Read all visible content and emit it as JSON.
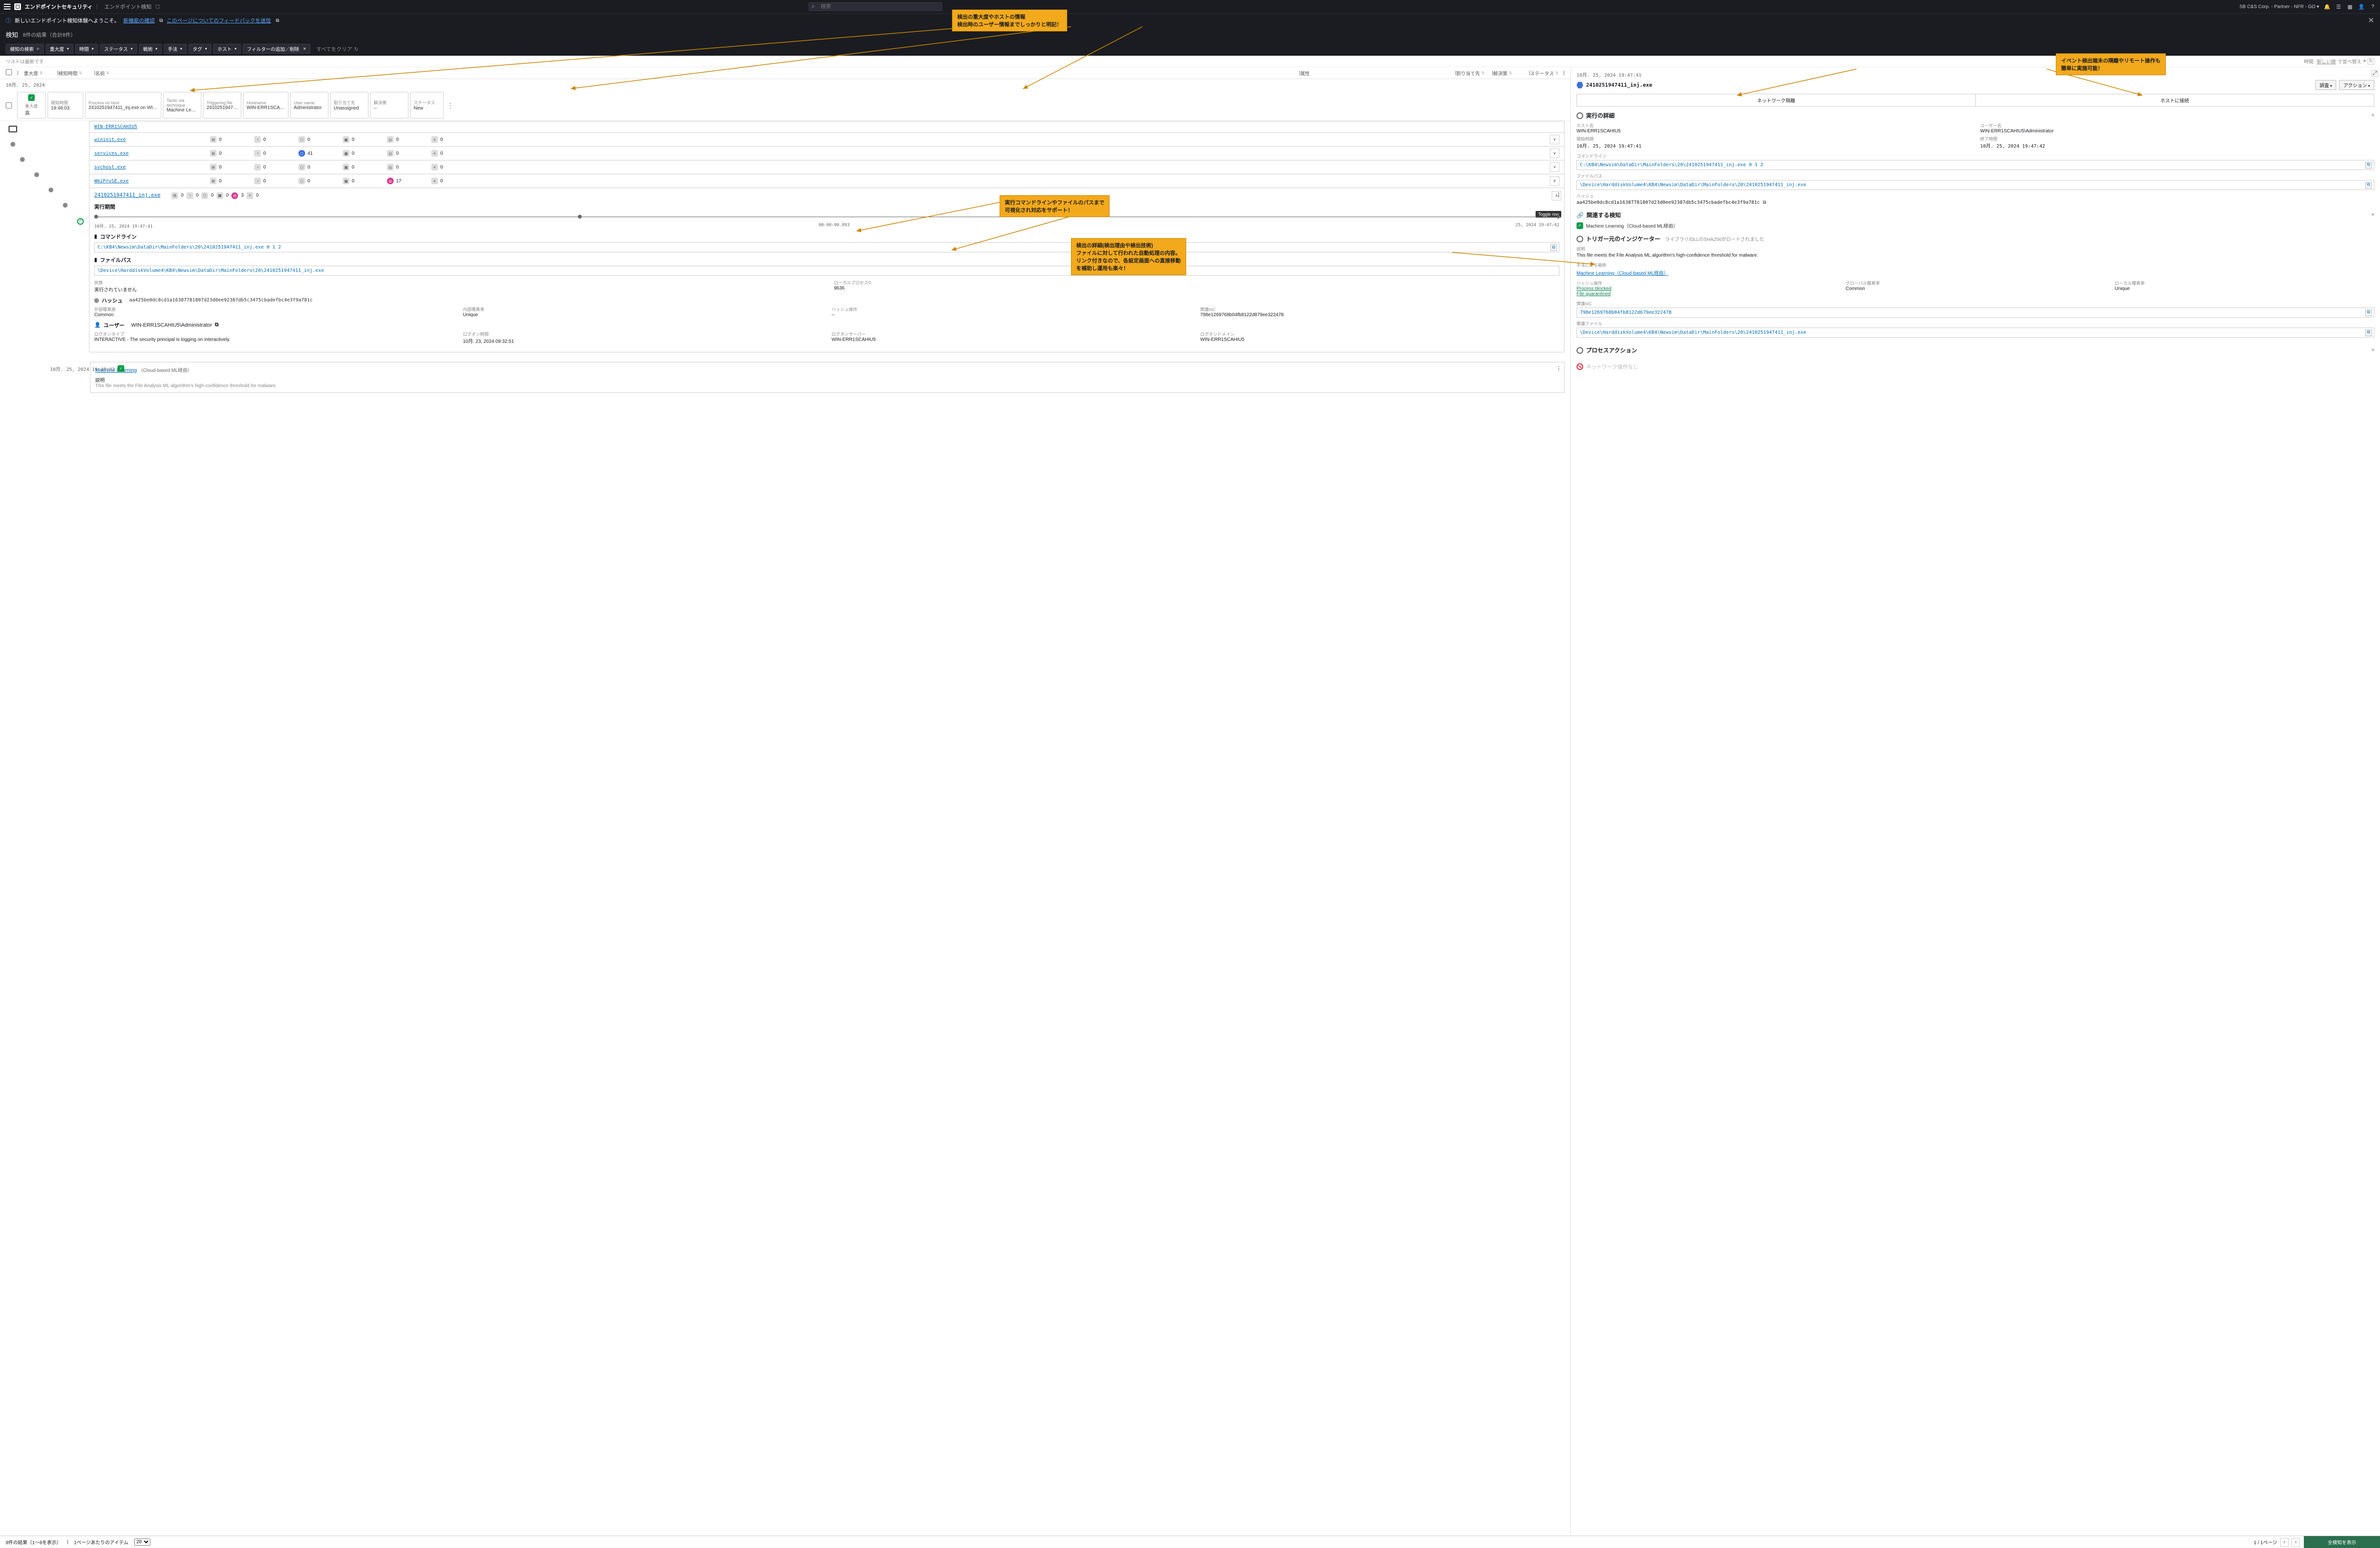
{
  "topbar": {
    "app_title": "エンドポイントセキュリティ",
    "subtitle": "エンドポイント検知",
    "bookmark_icon": "bookmark-icon",
    "search_placeholder": "検索",
    "tenant": "SB C&S Corp. - Partner - NFR - GO ▾"
  },
  "banner": {
    "text": "新しいエンドポイント検知体験へようこそ。",
    "link1": "新機能の確認",
    "link2": "このページについてのフィードバックを送信"
  },
  "result_header": {
    "title": "検知",
    "count_text": "8件の結果（合計8件）"
  },
  "filters": [
    {
      "label": "検知の検索",
      "cls": "search"
    },
    {
      "label": "重大度",
      "cls": "dd"
    },
    {
      "label": "時間",
      "cls": "dd"
    },
    {
      "label": "ステータス",
      "cls": "dd"
    },
    {
      "label": "戦術",
      "cls": "dd"
    },
    {
      "label": "手法",
      "cls": "dd"
    },
    {
      "label": "タグ",
      "cls": "dd"
    },
    {
      "label": "ホスト",
      "cls": "dd"
    },
    {
      "label": "フィルターの追加／削除",
      "cls": "close"
    }
  ],
  "filter_clear": "すべてをクリア",
  "statusbar": {
    "left": "リストは最新です",
    "sort_label": "時間:",
    "sort_value": "新しい順",
    "sort_suffix": "で並べ替え"
  },
  "columns": {
    "severity": "重大度",
    "time": "検知時間",
    "name": "名前",
    "attributes": "属性",
    "assigned": "割り当て先",
    "resolution": "解決策",
    "status": "ステータス"
  },
  "date_group": "10月. 25, 2024",
  "detection_row": {
    "severity_label": "重大度",
    "severity": "高",
    "time_label": "検知時間",
    "time": "19:48:03",
    "process_label": "Process on host",
    "process": "2410251947411_inj.exe on WIN-ERR1SCAHI...",
    "tactic_label": "Tactic via technique",
    "tactic": "Machine Learning...",
    "trigger_label": "Triggering file",
    "trigger": "2410251947411_inj...",
    "host_label": "Hostname",
    "host": "WIN-ERR1SCAHIU5",
    "user_label": "User name",
    "user": "Administrator",
    "assigned_label": "割り当て先",
    "assigned": "Unassigned",
    "resolution_label": "解決策",
    "resolution": "--",
    "status_label": "ステータス",
    "status": "New"
  },
  "process_tree": {
    "host": "WIN-ERR1SCAHIU5",
    "processes": [
      {
        "name": "wininit.exe",
        "s1": 0,
        "s2": 0,
        "s3": 0,
        "s4": 0,
        "s5": 0,
        "s6": 0,
        "highlight": null
      },
      {
        "name": "services.exe",
        "s1": 0,
        "s2": 0,
        "s3": 41,
        "s4": 0,
        "s5": 0,
        "s6": 0,
        "highlight": "blue"
      },
      {
        "name": "svchost.exe",
        "s1": 0,
        "s2": 0,
        "s3": 0,
        "s4": 0,
        "s5": 0,
        "s6": 0,
        "highlight": null
      },
      {
        "name": "WmiPrvSE.exe",
        "s1": 0,
        "s2": 0,
        "s3": 0,
        "s4": 0,
        "s5": 17,
        "s6": 0,
        "highlight": "pink"
      }
    ],
    "selected": {
      "name": "2410251947411_inj.exe",
      "stats_s1": 0,
      "stats_s2": 0,
      "stats_s3": 0,
      "stats_s4": 0,
      "stats_s5": 3,
      "stats_s6": 0,
      "runtime_label": "実行期間",
      "start": "10月. 25, 2024 19:47:41",
      "duration": "00:00:00.893",
      "end": "25, 2024 19:47:42",
      "cmd_label": "コマンドライン",
      "cmd": "C:\\KB4\\Newsim\\DataDir\\MainFolders\\20\\2410251947411_inj.exe 0 1 2",
      "path_label": "ファイルパス",
      "path": "\\Device\\HarddiskVolume4\\KB4\\Newsim\\DataDir\\MainFolders\\20\\2410251947411_inj.exe",
      "state_k": "状態",
      "state_v": "実行されていません",
      "localproc_k": "ローカルプロセス©",
      "localproc_v": "9636",
      "hash_label": "ハッシュ",
      "hash": "aa425be0dc8cd1a16387781807d23d0ee92387db5c3475cbadefbc4e3f9a781c",
      "ext_k": "外部曝真度",
      "ext_v": "Common",
      "int_k": "内部曝真率",
      "int_v": "Unique",
      "hashop_k": "ハッシュ操作",
      "hashop_v": "--",
      "relioc_k": "関連IoC",
      "relioc_v": "798e1269768b04fb8122d879ee322478",
      "user_label": "ユーザー",
      "user": "WIN-ERR1SCAHIU5\\Administrator",
      "logontype_k": "ログオンタイプ",
      "logontype_v": "INTERACTIVE - The security principal is logging on interactively.",
      "logontime_k": "ログオン時間",
      "logontime_v": "10月. 23, 2024 09:32:51",
      "logonserver_k": "ログオンサーバー",
      "logonserver_v": "WIN-ERR1SCAHIU5",
      "logondomain_k": "ログオンドメイン",
      "logondomain_v": "WIN-ERR1SCAHIU5",
      "toggle_tooltip": "Toggle row"
    },
    "ml_block": {
      "ts": "10月. 25, 2024 19:48:03",
      "title": "Machine Learning",
      "subtitle": "（Cloud-based ML経由）",
      "desc_label": "説明",
      "desc_cut": "This file meets the File Analysis ML algorithm's high-confidence threshold for malware"
    }
  },
  "right_panel": {
    "ts": "10月. 25, 2024 19:47:41",
    "proc_name": "2410251947411_inj.exe",
    "btn_investigate": "調査",
    "btn_action": "アクション",
    "tab_isolate": "ネットワーク隔離",
    "tab_connect": "ホストに接続",
    "exec_details": "実行の詳細",
    "host_k": "ホスト名",
    "host_v": "WIN-ERR1SCAHIU5",
    "user_k": "ユーザー名",
    "user_v": "WIN-ERR1SCAHIU5\\Administrator",
    "start_k": "開始時間",
    "start_v": "10月. 25, 2024 19:47:41",
    "end_k": "終了時間",
    "end_v": "10月. 25, 2024 19:47:42",
    "cmd_k": "コマンドライン",
    "cmd_v": "C:\\KB4\\Newsim\\DataDir\\MainFolders\\20\\2410251947411_inj.exe 0 1 2",
    "path_k": "ファイルパス",
    "path_v": "\\Device\\HarddiskVolume4\\KB4\\Newsim\\DataDir\\MainFolders\\20\\2410251947411_inj.exe",
    "hash_k": "ハッシュ",
    "hash_v": "aa425be0dc8cd1a16387781807d23d0ee92387db5c3475cbadefbc4e3f9a781c",
    "related_section": "関連する検知",
    "related_item": "Machine Learning（Cloud-based ML経由）",
    "trigger_section": "トリガー元のインジケーター",
    "trigger_desc": "ライブラリ/DLLのSHA256がロードされました",
    "trigger_note_k": "説明",
    "trigger_note_v": "This file meets the File Analysis ML algorithm's high-confidence threshold for malware.",
    "tech_k": "手法による戦術",
    "tech_v": "Machine Learning（Cloud-based ML経由）",
    "hashop_k": "ハッシュ操作",
    "hashop_v1": "Process blocked",
    "hashop_v2": "File quarantined",
    "global_k": "グローバル曝真率",
    "global_v": "Common",
    "local_k": "ローカル曝真率",
    "local_v": "Unique",
    "relioc_k": "関連IoC",
    "relioc_v": "798e1269768b04fb8122d679ee322478",
    "relfile_k": "関連ファイル",
    "relfile_v": "\\Device\\HarddiskVolume4\\KB4\\Newsim\\DataDir\\MainFolders\\20\\2410251947411_inj.exe",
    "proc_action": "プロセスアクション",
    "net_none": "ネットワーク操作なし"
  },
  "footer": {
    "results": "8件の結果（1～8を表示）",
    "per_page_label": "1ページあたりのアイテム",
    "per_page_value": "20",
    "page": "1 / 1ページ",
    "show_all": "全検知を表示"
  },
  "callouts": {
    "c1a": "検出の重大度やホストの情報",
    "c1b": "検出時のユーザー情報までしっかりと明記！",
    "c2a": "イベント検出端末の隔離やリモート操作も",
    "c2b": "簡単に実施可能！",
    "c3a": "実行コマンドラインやファイルのパスまで",
    "c3b": "可視化され対応をサポート！",
    "c4a": "検出の詳細(検出理由や検出技術)",
    "c4b": "ファイルに対して行われた自動処理の内容。",
    "c4c": "リンク付きなので、各設定画面への直接移動",
    "c4d": "を補助し運用も楽々！"
  }
}
